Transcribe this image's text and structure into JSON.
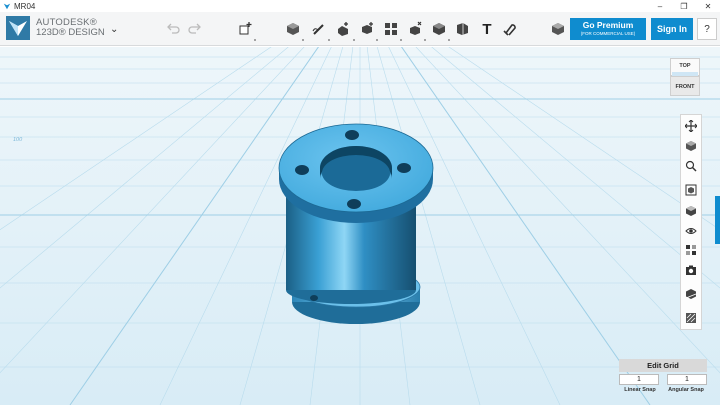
{
  "window": {
    "title": "MR04",
    "controls": [
      "–",
      "❐",
      "✕"
    ]
  },
  "brand": {
    "line1": "AUTODESK®",
    "line2": "123D® DESIGN"
  },
  "toolbar": {
    "menu_chevron": "⌄",
    "undo_icon": "undo-icon",
    "redo_icon": "redo-icon",
    "tools": [
      "transform",
      "primitives",
      "sketch",
      "construct",
      "modify",
      "pattern",
      "grouping",
      "combine",
      "measure",
      "text",
      "snap",
      "material"
    ],
    "text_tool_label": "T",
    "premium": {
      "label": "Go Premium",
      "sub": "(FOR COMMERCIAL USE)"
    },
    "signin": "Sign In",
    "help": "?"
  },
  "viewport": {
    "grid_label": "100",
    "accent_color": "#3fa8dc"
  },
  "navcube": {
    "top": "TOP",
    "front": "FRONT"
  },
  "right_tools": [
    "pan-icon",
    "orbit-icon",
    "zoom-icon",
    "fit-icon",
    "view-mode-icon",
    "visibility-icon",
    "materials-icon",
    "screenshot-icon",
    "grid-toggle-icon",
    "snap-icon"
  ],
  "edit_grid": {
    "button": "Edit Grid",
    "linear_value": "1",
    "angular_value": "1",
    "linear_label": "Linear Snap",
    "angular_label": "Angular Snap"
  }
}
